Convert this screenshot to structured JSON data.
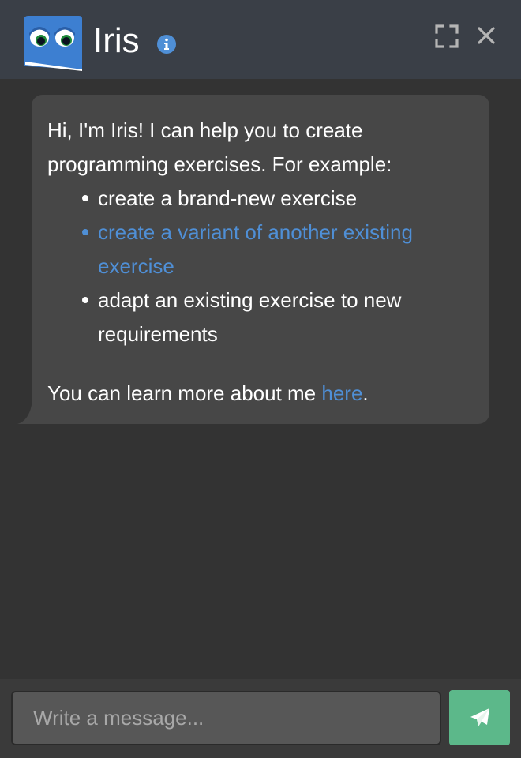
{
  "header": {
    "title": "Iris",
    "logo_icon": "iris-logo-icon",
    "info_icon": "info-icon",
    "fullscreen_icon": "fullscreen-icon",
    "close_icon": "close-icon"
  },
  "message": {
    "intro": "Hi, I'm Iris! I can help you to create programming exercises. For example:",
    "items": [
      "create a brand-new exercise",
      "create a variant of another existing exercise",
      "adapt an existing exercise to new requirements"
    ],
    "learn_more_prefix": "You can learn more about me ",
    "learn_more_link": "here",
    "learn_more_suffix": "."
  },
  "composer": {
    "placeholder": "Write a message...",
    "send_icon": "paper-plane-icon"
  },
  "colors": {
    "header_bg": "#3a3f47",
    "chat_bg": "#333333",
    "bubble_bg": "#474747",
    "link": "#4f8fd6",
    "send_button": "#5cb88a",
    "logo_blue": "#3d7fd1"
  }
}
